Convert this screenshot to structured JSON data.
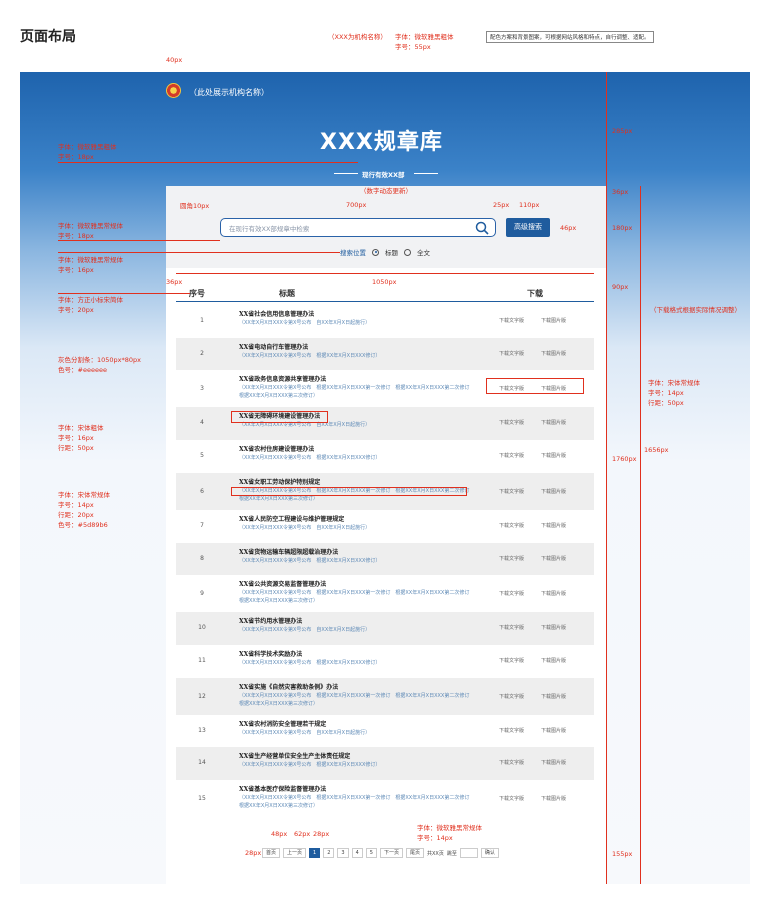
{
  "page_title": "页面布局",
  "header": {
    "org_name": "（此处展示机构名称）",
    "library_title": "XXX规章库",
    "subtitle": "现行有效XX部"
  },
  "search": {
    "placeholder": "在现行有效XX部规章中检索",
    "advanced_label": "高级搜索",
    "scope_label": "搜索位置",
    "options": [
      "标题",
      "全文"
    ],
    "selected": "标题"
  },
  "table": {
    "col_no": "序号",
    "col_title": "标题",
    "col_download": "下载",
    "download_text": "下载文字版",
    "download_image": "下载图片版",
    "rows": [
      {
        "no": "1",
        "title": "XX省社会信用信息管理办法",
        "meta": "（XX年X月X日XXX令第X号公布　自XX年X月X日起施行）"
      },
      {
        "no": "2",
        "title": "XX省电动自行车管理办法",
        "meta": "（XX年X月X日XXX令第X号公布　根据XX年X月X日XXX修订）"
      },
      {
        "no": "3",
        "title": "XX省政务信息资源共享管理办法",
        "meta": "（XX年X月X日XXX令第X号公布　根据XX年X月X日XXX第一次修订　根据XX年X月X日XXX第二次修订　根据XX年X月X日XXX第三次修订）"
      },
      {
        "no": "4",
        "title": "XX省无障碍环境建设管理办法",
        "meta": "（XX年X月X日XXX令第X号公布　自XX年X月X日起施行）"
      },
      {
        "no": "5",
        "title": "XX省农村住房建设管理办法",
        "meta": "（XX年X月X日XXX令第X号公布　根据XX年X月X日XXX修订）"
      },
      {
        "no": "6",
        "title": "XX省女职工劳动保护特别规定",
        "meta": "（XX年X月X日XXX令第X号公布　根据XX年X月X日XXX第一次修订　根据XX年X月X日XXX第二次修订　根据XX年X月X日XXX第三次修订）"
      },
      {
        "no": "7",
        "title": "XX省人民防空工程建设与维护管理规定",
        "meta": "（XX年X月X日XXX令第X号公布　自XX年X月X日起施行）"
      },
      {
        "no": "8",
        "title": "XX省货物运输车辆超限超载治理办法",
        "meta": "（XX年X月X日XXX令第X号公布　根据XX年X月X日XXX修订）"
      },
      {
        "no": "9",
        "title": "XX省公共资源交易监督管理办法",
        "meta": "（XX年X月X日XXX令第X号公布　根据XX年X月X日XXX第一次修订　根据XX年X月X日XXX第二次修订　根据XX年X月X日XXX第三次修订）"
      },
      {
        "no": "10",
        "title": "XX省节约用水管理办法",
        "meta": "（XX年X月X日XXX令第X号公布　自XX年X月X日起施行）"
      },
      {
        "no": "11",
        "title": "XX省科学技术奖励办法",
        "meta": "（XX年X月X日XXX令第X号公布　根据XX年X月X日XXX修订）"
      },
      {
        "no": "12",
        "title": "XX省实施《自然灾害救助条例》办法",
        "meta": "（XX年X月X日XXX令第X号公布　根据XX年X月X日XXX第一次修订　根据XX年X月X日XXX第二次修订　根据XX年X月X日XXX第三次修订）"
      },
      {
        "no": "13",
        "title": "XX省农村消防安全管理若干规定",
        "meta": "（XX年X月X日XXX令第X号公布　自XX年X月X日起施行）"
      },
      {
        "no": "14",
        "title": "XX省生产经营单位安全生产主体责任规定",
        "meta": "（XX年X月X日XXX令第X号公布　根据XX年X月X日XXX修订）"
      },
      {
        "no": "15",
        "title": "XX省基本医疗保险监督管理办法",
        "meta": "（XX年X月X日XXX令第X号公布　根据XX年X月X日XXX第一次修订　根据XX年X月X日XXX第二次修订　根据XX年X月X日XXX第三次修订）"
      }
    ]
  },
  "pager": {
    "first": "首页",
    "prev": "上一页",
    "pages": [
      "1",
      "2",
      "3",
      "4",
      "5"
    ],
    "current": "1",
    "next": "下一页",
    "last": "尾页",
    "total": "共XX页",
    "jump": "跳至",
    "confirm": "确认"
  },
  "annotations": {
    "org_note": "（XXX为机构名称）",
    "title_font": "字体：微软雅黑粗体\n字号：55px",
    "color_note": "配色方案和背景图案，可根据网站风格和特点，自行调整、适配。",
    "px40": "40px",
    "px285": "285px",
    "sub_font": "字体：微软雅黑粗体\n字号：18px",
    "dynamic": "（数字动态更新）",
    "px36": "36px",
    "radius": "圆角10px",
    "px700": "700px",
    "px25": "25px",
    "px110": "110px",
    "px46": "46px",
    "px180": "180px",
    "search_font": "字体：微软雅黑常规体\n字号：18px",
    "scope_font": "字体：微软雅黑常规体\n字号：16px",
    "px1050": "1050px",
    "px36b": "36px",
    "px90": "90px",
    "head_font": "字体：方正小标宋简体\n字号：20px",
    "dl_note": "（下载格式根据实际情况调整）",
    "gray_note": "灰色分割条：1050px*80px\n色号：#eeeeee",
    "dl_font": "字体：宋体常规体\n字号：14px\n行距：50px",
    "row_font": "字体：宋体粗体\n字号：16px\n行距：50px",
    "px1656": "1656px",
    "px1760": "1760px",
    "meta_font": "字体：宋体常规体\n字号：14px\n行距：20px\n色号：#5d89b6",
    "px48": "48px",
    "px62": "62px",
    "px28": "28px",
    "px28b": "28px",
    "pager_font": "字体：微软雅黑常规体\n字号：14px",
    "px155": "155px"
  }
}
